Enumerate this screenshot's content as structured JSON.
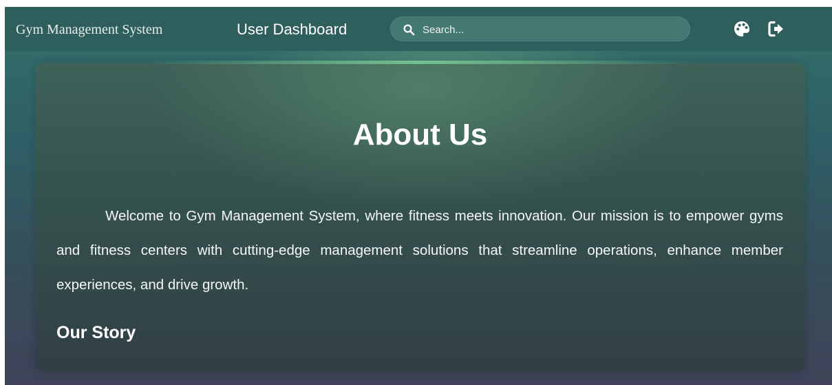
{
  "navbar": {
    "brand": "Gym Management System",
    "dashboard_link": "User Dashboard",
    "search": {
      "placeholder": "Search...",
      "value": ""
    },
    "icons": [
      "search-icon",
      "palette-icon",
      "logout-icon"
    ]
  },
  "about": {
    "title": "About Us",
    "intro": "Welcome to Gym Management System, where fitness meets innovation. Our mission is to empower gyms and fitness centers with cutting-edge management solutions that streamline operations, enhance member experiences, and drive growth.",
    "story_heading": "Our Story"
  },
  "colors": {
    "navbar": "#2f5f5d",
    "search_bg": "#447873",
    "accent_glow": "#78c896",
    "text": "#ffffff"
  }
}
